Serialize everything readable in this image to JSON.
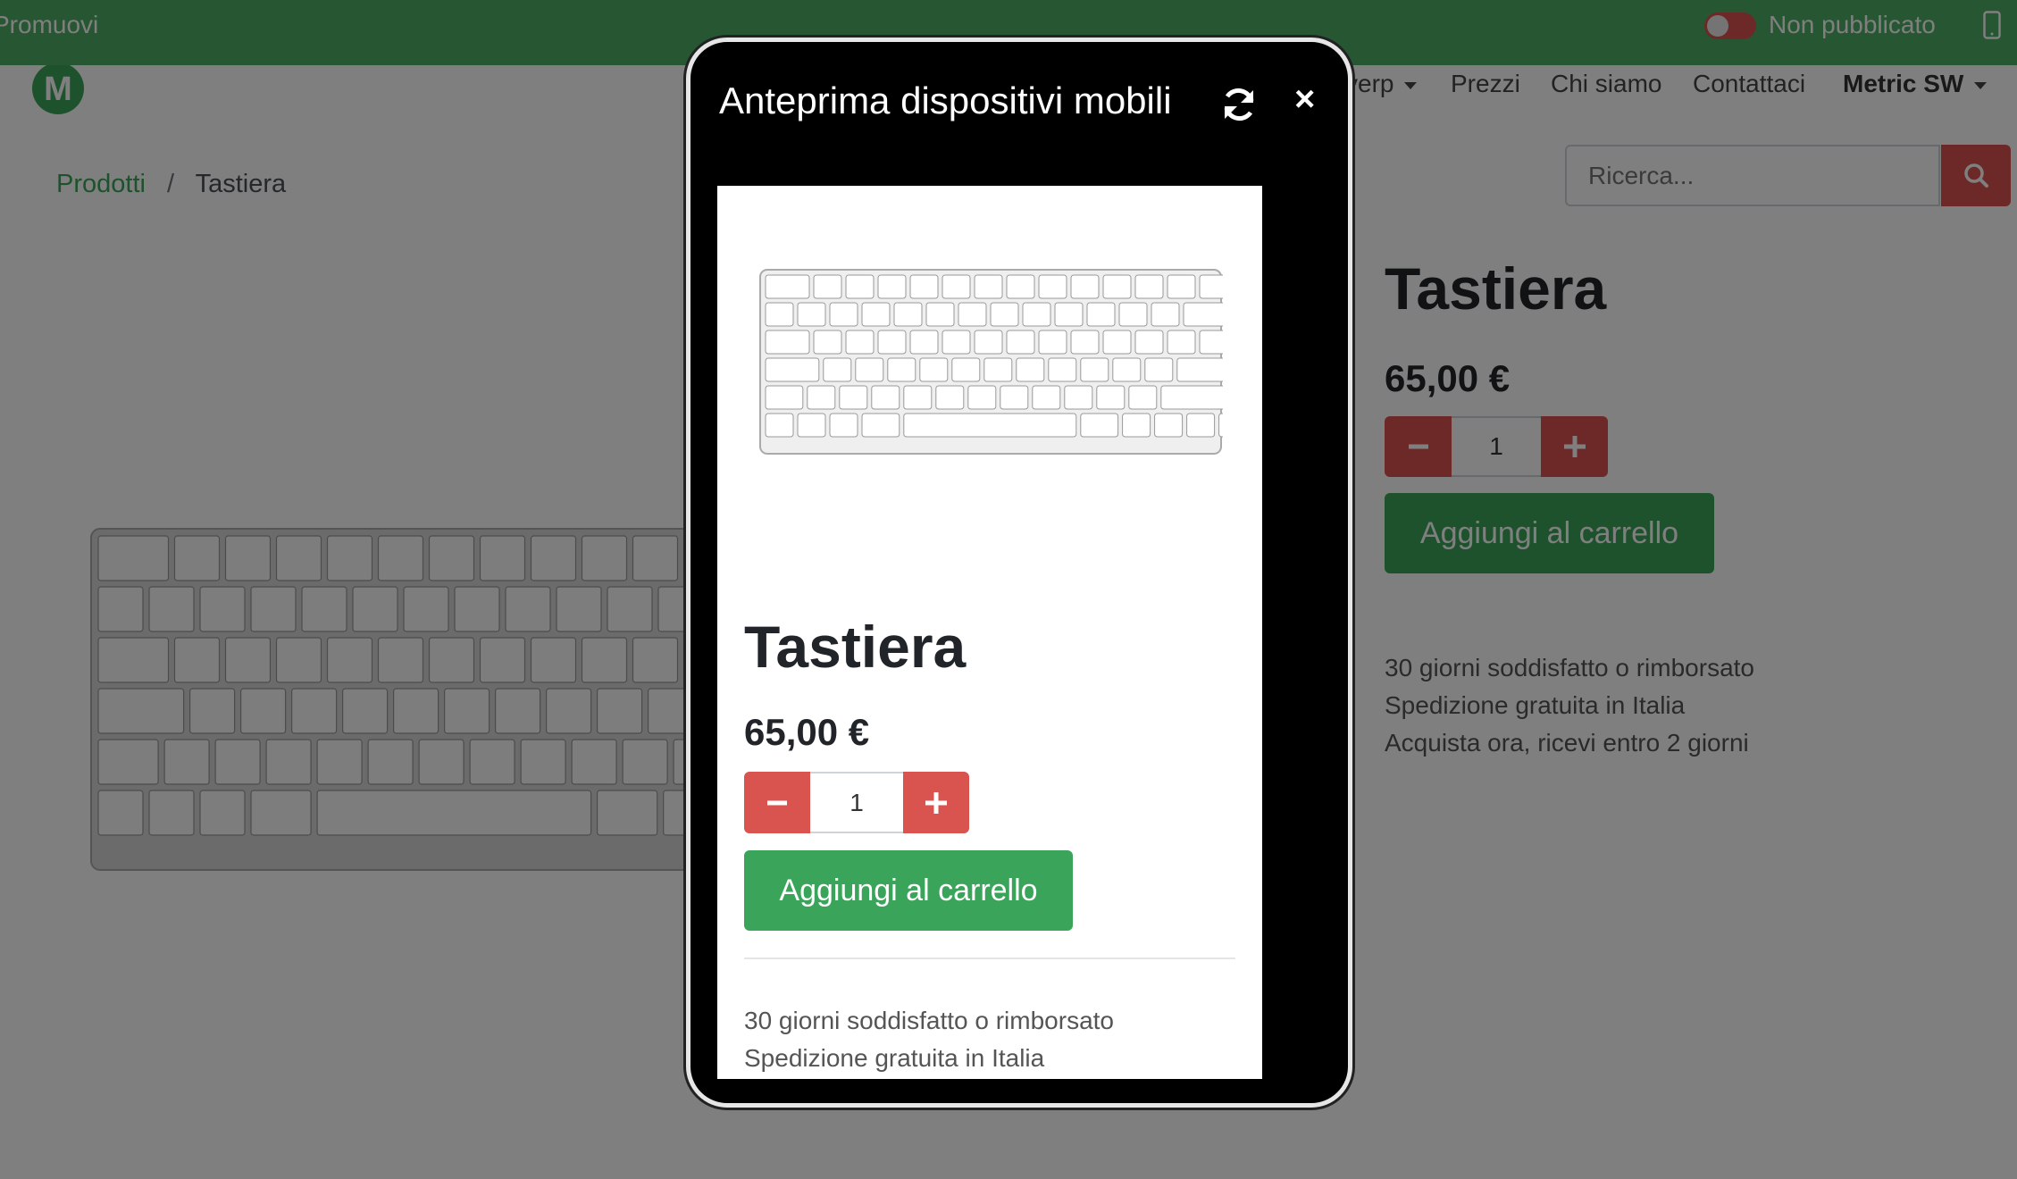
{
  "editor_bar": {
    "promote_label": "Promuovi",
    "publish_status": "Non pubblicato"
  },
  "navbar": {
    "menu_partial": "verp",
    "items": [
      "Prezzi",
      "Chi siamo",
      "Contattaci"
    ],
    "user": "Metric SW"
  },
  "breadcrumb": {
    "parent": "Prodotti",
    "separator": "/",
    "current": "Tastiera"
  },
  "search": {
    "placeholder": "Ricerca..."
  },
  "product": {
    "title": "Tastiera",
    "price": "65,00 €",
    "quantity": "1",
    "add_to_cart": "Aggiungi al carrello",
    "benefits": [
      "30 giorni soddisfatto o rimborsato",
      "Spedizione gratuita in Italia",
      "Acquista ora, ricevi entro 2 giorni"
    ]
  },
  "mobile_preview": {
    "title": "Anteprima dispositivi mobili",
    "product_title": "Tastiera",
    "price": "65,00 €",
    "quantity": "1",
    "add_to_cart": "Aggiungi al carrello",
    "benefits": [
      "30 giorni soddisfatto o rimborsato",
      "Spedizione gratuita in Italia"
    ]
  },
  "colors": {
    "brand_green": "#4caf64",
    "button_green": "#3aa55a",
    "danger_red": "#d9534f"
  }
}
